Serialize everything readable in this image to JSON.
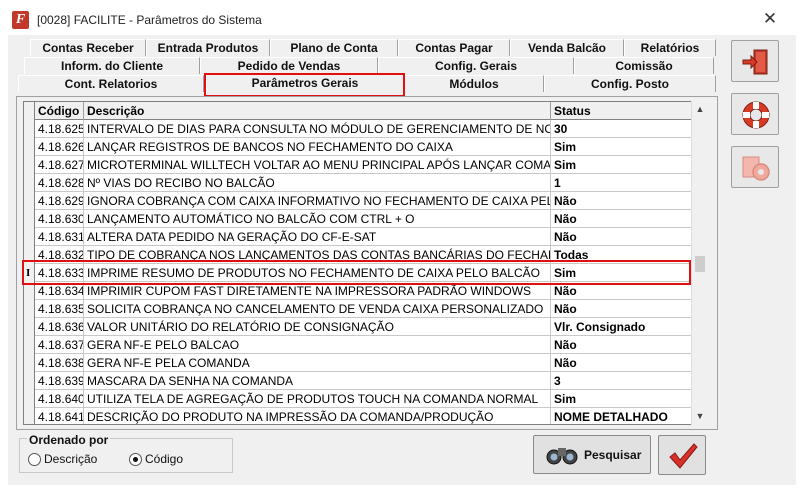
{
  "window": {
    "title": "[0028] FACILITE - Parâmetros do Sistema",
    "app_icon_letter": "F",
    "close_glyph": "✕"
  },
  "tabs": {
    "row1": [
      "Contas Receber",
      "Entrada Produtos",
      "Plano de Conta",
      "Contas Pagar",
      "Venda Balcão",
      "Relatórios"
    ],
    "row2": [
      "Inform. do Cliente",
      "Pedido de Vendas",
      "Config. Gerais",
      "Comissão"
    ],
    "row3": [
      "Cont. Relatorios",
      "Parâmetros Gerais",
      "Módulos",
      "Config. Posto"
    ],
    "active": "Parâmetros Gerais"
  },
  "grid": {
    "columns": [
      "Código",
      "Descrição",
      "Status"
    ],
    "current_row_marker": "I",
    "selected_code": "4.18.633",
    "rows": [
      {
        "code": "4.18.625",
        "desc": "INTERVALO DE DIAS PARA CONSULTA NO MÓDULO DE GERENCIAMENTO DE NOTA FISC",
        "status": "30"
      },
      {
        "code": "4.18.626",
        "desc": "LANÇAR REGISTROS DE BANCOS NO FECHAMENTO DO CAIXA",
        "status": "Sim"
      },
      {
        "code": "4.18.627",
        "desc": "MICROTERMINAL WILLTECH VOLTAR AO MENU PRINCIPAL APÓS LANÇAR COMANDA",
        "status": "Sim"
      },
      {
        "code": "4.18.628",
        "desc": "Nº VIAS DO RECIBO NO BALCÃO",
        "status": "1"
      },
      {
        "code": "4.18.629",
        "desc": "IGNORA COBRANÇA COM CAIXA INFORMATIVO NO FECHAMENTO DE CAIXA PELO RETAGI",
        "status": "Não"
      },
      {
        "code": "4.18.630",
        "desc": "LANÇAMENTO AUTOMÁTICO NO BALCÃO COM CTRL + O",
        "status": "Não"
      },
      {
        "code": "4.18.631",
        "desc": "ALTERA DATA PEDIDO NA GERAÇÃO DO CF-E-SAT",
        "status": "Não"
      },
      {
        "code": "4.18.632",
        "desc": "TIPO DE COBRANÇA NOS LANÇAMENTOS DAS CONTAS BANCÁRIAS DO FECHAMENTO DE",
        "status": "Todas"
      },
      {
        "code": "4.18.633",
        "desc": "IMPRIME RESUMO DE PRODUTOS NO FECHAMENTO DE CAIXA PELO BALCÃO",
        "status": "Sim"
      },
      {
        "code": "4.18.634",
        "desc": "IMPRIMIR CUPOM FAST DIRETAMENTE NA IMPRESSORA PADRÃO WINDOWS",
        "status": "Não"
      },
      {
        "code": "4.18.635",
        "desc": "SOLICITA COBRANÇA NO CANCELAMENTO DE VENDA CAIXA PERSONALIZADO",
        "status": "Não"
      },
      {
        "code": "4.18.636",
        "desc": "VALOR UNITÁRIO DO RELATÓRIO DE CONSIGNAÇÃO",
        "status": "Vlr. Consignado"
      },
      {
        "code": "4.18.637",
        "desc": "GERA NF-E PELO BALCAO",
        "status": "Não"
      },
      {
        "code": "4.18.638",
        "desc": "GERA NF-E PELA COMANDA",
        "status": "Não"
      },
      {
        "code": "4.18.639",
        "desc": "MASCARA DA SENHA NA COMANDA",
        "status": "3"
      },
      {
        "code": "4.18.640",
        "desc": "UTILIZA TELA DE AGREGAÇÃO DE PRODUTOS TOUCH NA COMANDA NORMAL",
        "status": "Sim"
      },
      {
        "code": "4.18.641",
        "desc": "DESCRIÇÃO DO PRODUTO NA IMPRESSÃO DA COMANDA/PRODUÇÃO",
        "status": "NOME DETALHADO"
      }
    ]
  },
  "order": {
    "label": "Ordenado por",
    "options": [
      "Descrição",
      "Código"
    ],
    "selected": "Código"
  },
  "buttons": {
    "search": "Pesquisar"
  },
  "icons": {
    "exit": "exit-door-icon",
    "help": "lifebuoy-icon",
    "config": "gears-icon",
    "search": "binoculars-icon",
    "confirm": "checkmark-icon"
  },
  "colors": {
    "highlight_border": "#e01010",
    "accent_red": "#c0392b"
  }
}
